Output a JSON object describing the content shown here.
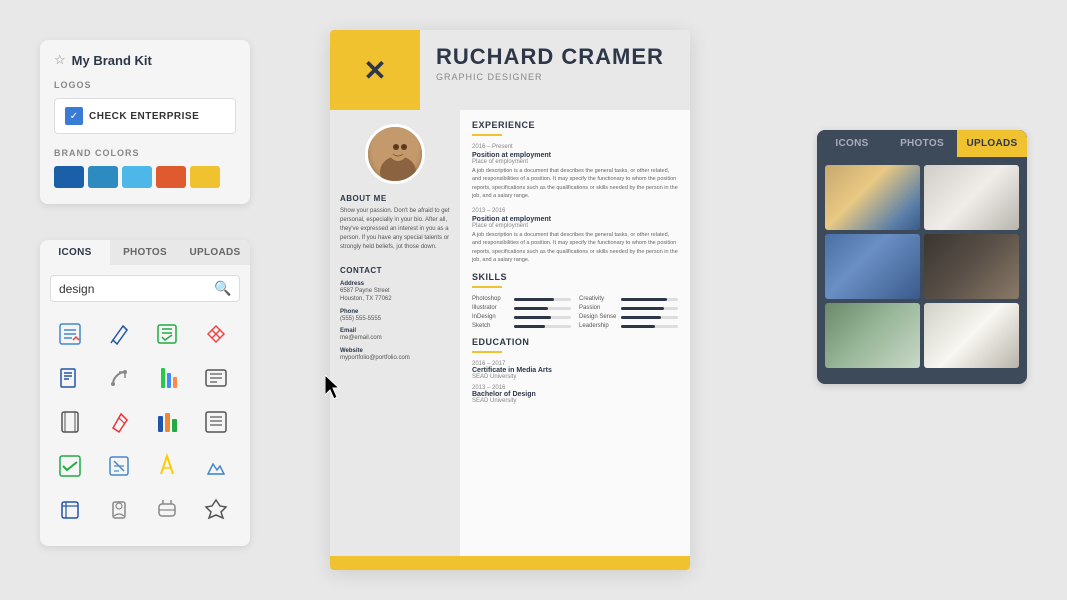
{
  "brandKit": {
    "title": "My Brand Kit",
    "logosLabel": "LOGOS",
    "logoText": "CHECK ENTERPRISE",
    "brandColorsLabel": "BRAND COLORS",
    "colors": [
      "#1a5fa8",
      "#2e8bc0",
      "#4db8e8",
      "#e05a30",
      "#f0c230"
    ]
  },
  "iconsPanel": {
    "tabs": [
      "ICONS",
      "PHOTOS",
      "UPLOADS"
    ],
    "activeTab": "ICONS",
    "searchPlaceholder": "design",
    "icons": [
      "✏️",
      "🖊️",
      "📋",
      "✂️",
      "✏️",
      "❌",
      "✒️",
      "📏",
      "🗒️",
      "❌",
      "📊",
      "📝",
      "📋",
      "🖊️",
      "🖍️",
      "✏️",
      "🖊️",
      "📦",
      "🎁",
      "📦"
    ]
  },
  "resume": {
    "name": "RUCHARD CRAMER",
    "jobTitle": "GRAPHIC DESIGNER",
    "experience": {
      "title": "EXPERIENCE",
      "items": [
        {
          "years": "2016 – Present",
          "position": "Position at employment",
          "company": "Place of employment",
          "description": "A job description is a document that describes the general tasks, or other related, and responsibilities of a position. It may specify the functionary to whom the position reports, specifications such as the qualifications or skills needed by the person in the job, and a salary range."
        },
        {
          "years": "2013 – 2016",
          "position": "Position at employment",
          "company": "Place of employment",
          "description": "A job description is a document that describes the general tasks, or other related, and responsibilities of a position. It may specify the functionary to whom the position reports, specifications such as the qualifications or skills needed by the person in the job, and a salary range."
        }
      ]
    },
    "skills": {
      "title": "SKILLS",
      "items": [
        {
          "name": "Photoshop",
          "level": 70
        },
        {
          "name": "Creativity",
          "level": 80
        },
        {
          "name": "Illustrator",
          "level": 60
        },
        {
          "name": "Passion",
          "level": 75
        },
        {
          "name": "InDesign",
          "level": 65
        },
        {
          "name": "Design Sense",
          "level": 70
        },
        {
          "name": "Sketch",
          "level": 55
        },
        {
          "name": "Leadership",
          "level": 60
        }
      ]
    },
    "education": {
      "title": "EDUCATION",
      "items": [
        {
          "years": "2016 – 2017",
          "degree": "Certificate in Media Arts",
          "school": "SEAD University"
        },
        {
          "years": "2013 – 2016",
          "degree": "Bachelor of Design",
          "school": "SEAD University"
        }
      ]
    },
    "aboutMe": {
      "title": "ABOUT ME",
      "text": "Show your passion. Don't be afraid to get personal, especially in your bio. After all, they've expressed an interest in you as a person. If you have any special talents or strongly held beliefs, jot those down."
    },
    "contact": {
      "title": "CONTACT",
      "address": {
        "label": "Address",
        "value": "6587 Payne Street\nHouston, TX 77062"
      },
      "phone": {
        "label": "Phone",
        "value": "(555) 555-5555"
      },
      "email": {
        "label": "Email",
        "value": "me@email.com"
      },
      "website": {
        "label": "Website",
        "value": "myportfolio@portfolio.com"
      }
    }
  },
  "photosPanel": {
    "tabs": [
      "ICONS",
      "PHOTOS",
      "UPLOADS"
    ],
    "activeTab": "UPLOADS"
  }
}
